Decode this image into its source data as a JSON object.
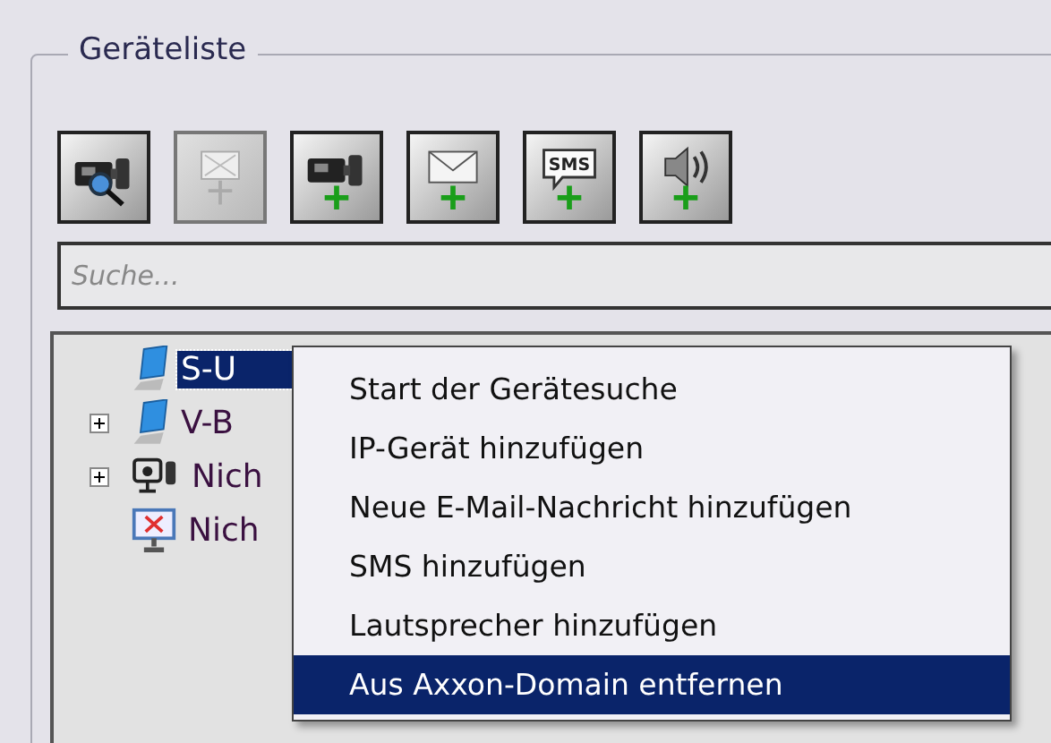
{
  "group": {
    "title": "Geräteliste"
  },
  "toolbar": [
    {
      "kind": "camera-search",
      "disabled": false
    },
    {
      "kind": "monitor-add",
      "disabled": true
    },
    {
      "kind": "camera-add",
      "disabled": false
    },
    {
      "kind": "mail-add",
      "disabled": false
    },
    {
      "kind": "sms-add",
      "disabled": false,
      "icon_text": "SMS"
    },
    {
      "kind": "speaker-add",
      "disabled": false
    }
  ],
  "search": {
    "placeholder": "Suche..."
  },
  "tree": [
    {
      "label": "S-U",
      "kind": "server",
      "expandable": false,
      "selected": true
    },
    {
      "label": "V-B",
      "kind": "server",
      "expandable": true,
      "selected": false
    },
    {
      "label": "Nich",
      "kind": "camera-group",
      "expandable": true,
      "selected": false
    },
    {
      "label": "Nich",
      "kind": "monitor-error",
      "expandable": false,
      "selected": false
    }
  ],
  "context_menu": [
    {
      "label": "Start der Gerätesuche",
      "selected": false
    },
    {
      "label": "IP-Gerät hinzufügen",
      "selected": false
    },
    {
      "label": "Neue E-Mail-Nachricht hinzufügen",
      "selected": false
    },
    {
      "label": "SMS hinzufügen",
      "selected": false
    },
    {
      "label": "Lautsprecher hinzufügen",
      "selected": false
    },
    {
      "label": "Aus Axxon-Domain entfernen",
      "selected": true
    }
  ]
}
